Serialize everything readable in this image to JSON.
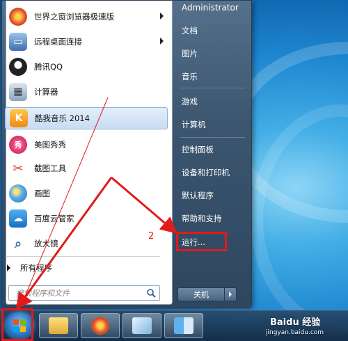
{
  "programs": [
    {
      "label": "世界之窗浏览器极速版",
      "icon": "world-browser-icon",
      "color": "#e8452a",
      "has_submenu": true
    },
    {
      "label": "远程桌面连接",
      "icon": "remote-desktop-icon",
      "color": "#4d7fc0",
      "has_submenu": true
    },
    {
      "label": "腾讯QQ",
      "icon": "qq-penguin-icon",
      "color": "#222222",
      "has_submenu": false
    },
    {
      "label": "计算器",
      "icon": "calculator-icon",
      "color": "#6b8fb3",
      "has_submenu": false
    },
    {
      "label": "酷我音乐 2014",
      "icon": "kuwo-music-icon",
      "color": "#f39a1b",
      "has_submenu": false,
      "highlighted": true
    },
    {
      "label": "美图秀秀",
      "icon": "meitu-icon",
      "color": "#e0316e",
      "has_submenu": false
    },
    {
      "label": "截图工具",
      "icon": "snipping-tool-icon",
      "color": "#d64a3a",
      "has_submenu": false
    },
    {
      "label": "画图",
      "icon": "paint-icon",
      "color": "#3e87c9",
      "has_submenu": false
    },
    {
      "label": "百度云管家",
      "icon": "baidu-cloud-icon",
      "color": "#2a8ee0",
      "has_submenu": false
    },
    {
      "label": "放大镜",
      "icon": "magnifier-icon",
      "color": "#5a86b6",
      "has_submenu": false
    }
  ],
  "all_programs_label": "所有程序",
  "search_placeholder": "搜索程序和文件",
  "right_items": [
    "Administrator",
    "文档",
    "图片",
    "音乐",
    "游戏",
    "计算机",
    "控制面板",
    "设备和打印机",
    "默认程序",
    "帮助和支持",
    "运行..."
  ],
  "shutdown_label": "关机",
  "annotation_number": "2",
  "watermark": {
    "brand": "Baidu 经验",
    "url": "jingyan.baidu.com"
  },
  "taskbar_items": [
    "start-orb",
    "world-browser",
    "file-explorer",
    "notepad",
    "finder"
  ],
  "colors": {
    "highlight_red": "#e21a1a",
    "menu_dark": "#3c5670",
    "menu_light": "#ffffff"
  }
}
